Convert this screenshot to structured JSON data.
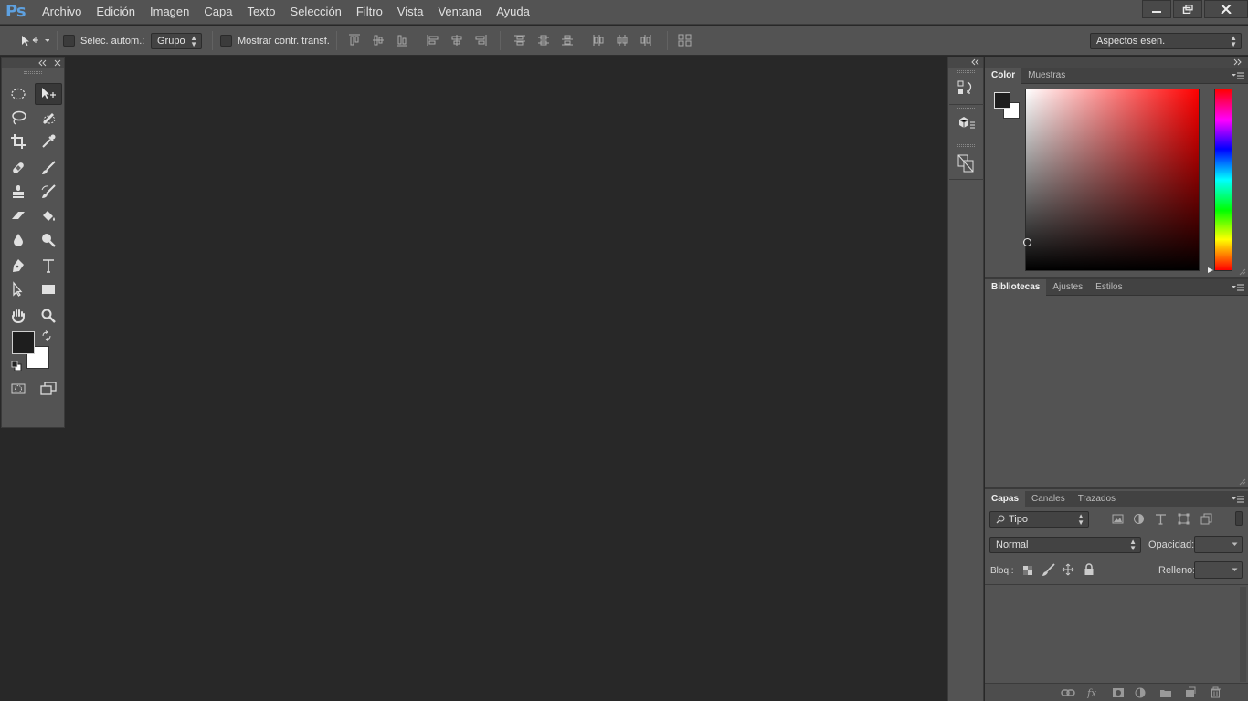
{
  "app": {
    "logo": "Ps"
  },
  "menu": [
    "Archivo",
    "Edición",
    "Imagen",
    "Capa",
    "Texto",
    "Selección",
    "Filtro",
    "Vista",
    "Ventana",
    "Ayuda"
  ],
  "options": {
    "auto_select_label": "Selec. autom.:",
    "auto_select_target": "Grupo",
    "show_transform_label": "Mostrar contr. transf.",
    "workspace": "Aspectos esen."
  },
  "color_panel": {
    "tabs": [
      "Color",
      "Muestras"
    ]
  },
  "libraries_panel": {
    "tabs": [
      "Bibliotecas",
      "Ajustes",
      "Estilos"
    ]
  },
  "layers_panel": {
    "tabs": [
      "Capas",
      "Canales",
      "Trazados"
    ],
    "filter_kind": "Tipo",
    "blend_mode": "Normal",
    "opacity_label": "Opacidad:",
    "lock_label": "Bloq.:",
    "fill_label": "Relleno:"
  },
  "colors": {
    "foreground": "#1e1e1e",
    "background": "#ffffff",
    "accent": "#5ea1e0"
  },
  "icons": {
    "tools": [
      "elliptical-marquee-icon",
      "move-icon",
      "lasso-icon",
      "quick-selection-icon",
      "crop-icon",
      "eyedropper-icon",
      "healing-brush-icon",
      "brush-icon",
      "clone-stamp-icon",
      "history-brush-icon",
      "eraser-icon",
      "paint-bucket-icon",
      "blur-icon",
      "dodge-icon",
      "pen-icon",
      "type-icon",
      "path-selection-icon",
      "rectangle-icon",
      "hand-icon",
      "zoom-icon"
    ]
  }
}
